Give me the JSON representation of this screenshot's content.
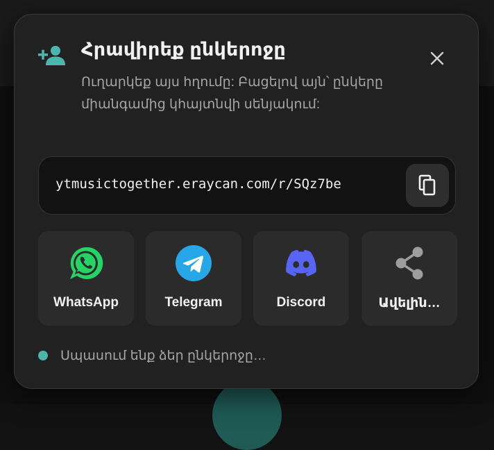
{
  "dialog": {
    "title": "Հրավիրեք ընկերոջը",
    "subtitle": "Ուղարկեք այս հղումը: Բացելով այն՝ ընկերը միանգամից կհայտնվի սենյակում:",
    "header_icon": "person-add-icon",
    "close_icon": "close-icon",
    "accent_color": "#4db6ac"
  },
  "link": {
    "url": "ytmusictogether.eraycan.com/r/SQz7be",
    "copy_icon": "copy-icon"
  },
  "share_options": [
    {
      "label": "WhatsApp",
      "icon": "whatsapp-icon",
      "color": "#25d366"
    },
    {
      "label": "Telegram",
      "icon": "telegram-icon",
      "color": "#27a7e7"
    },
    {
      "label": "Discord",
      "icon": "discord-icon",
      "color": "#5865f2"
    },
    {
      "label": "Ավելին…",
      "icon": "share-icon",
      "color": "#9e9e9e"
    }
  ],
  "status": {
    "text": "Սպասում ենք ձեր ընկերոջը…",
    "dot_color": "#4db6ac"
  }
}
